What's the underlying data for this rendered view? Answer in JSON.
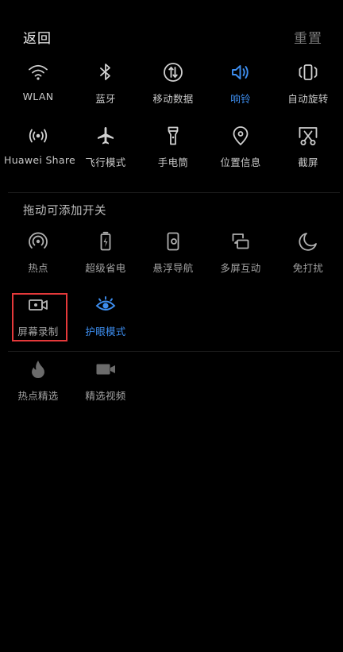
{
  "header": {
    "back_label": "返回",
    "reset_label": "重置"
  },
  "active_tiles": {
    "row1": [
      {
        "label": "WLAN",
        "icon": "wifi-icon",
        "active": false
      },
      {
        "label": "蓝牙",
        "icon": "bluetooth-icon",
        "active": false
      },
      {
        "label": "移动数据",
        "icon": "mobile-data-icon",
        "active": false
      },
      {
        "label": "响铃",
        "icon": "volume-ring-icon",
        "active": true
      },
      {
        "label": "自动旋转",
        "icon": "auto-rotate-icon",
        "active": false
      }
    ],
    "row2": [
      {
        "label": "Huawei Share",
        "icon": "huawei-share-icon",
        "active": false
      },
      {
        "label": "飞行模式",
        "icon": "airplane-icon",
        "active": false
      },
      {
        "label": "手电筒",
        "icon": "flashlight-icon",
        "active": false
      },
      {
        "label": "位置信息",
        "icon": "location-icon",
        "active": false
      },
      {
        "label": "截屏",
        "icon": "screenshot-icon",
        "active": false
      }
    ]
  },
  "addable": {
    "title": "拖动可添加开关",
    "row1": [
      {
        "label": "热点",
        "icon": "hotspot-icon"
      },
      {
        "label": "超级省电",
        "icon": "power-saving-icon"
      },
      {
        "label": "悬浮导航",
        "icon": "floating-nav-icon"
      },
      {
        "label": "多屏互动",
        "icon": "multi-screen-icon"
      },
      {
        "label": "免打扰",
        "icon": "do-not-disturb-icon"
      }
    ],
    "row2": [
      {
        "label": "屏幕录制",
        "icon": "screen-record-icon",
        "active": false
      },
      {
        "label": "护眼模式",
        "icon": "eye-comfort-icon",
        "active": true
      }
    ]
  },
  "extra": {
    "row1": [
      {
        "label": "热点精选",
        "icon": "flame-icon"
      },
      {
        "label": "精选视频",
        "icon": "video-icon"
      }
    ]
  },
  "colors": {
    "background": "#000000",
    "active_blue": "#3d8ef0",
    "highlight_red": "#e5393a"
  }
}
